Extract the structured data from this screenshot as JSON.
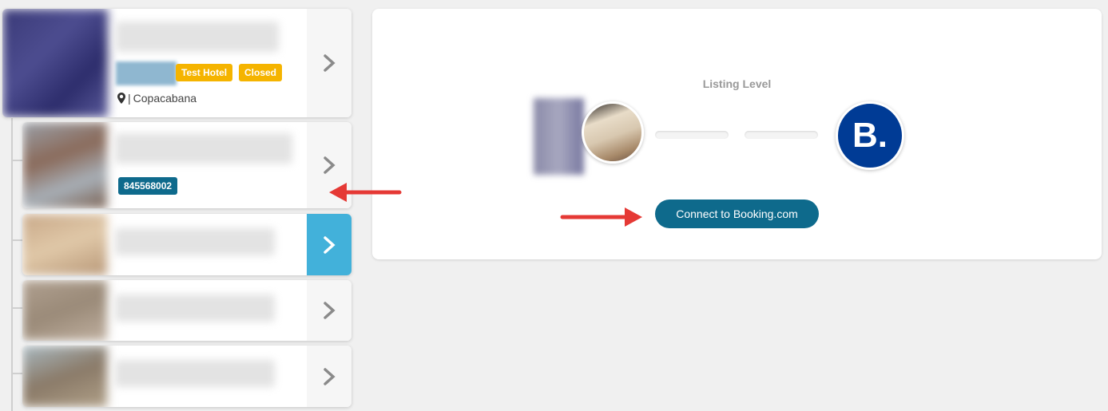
{
  "hotels": [
    {
      "tags": [
        "Test Hotel",
        "Closed"
      ],
      "location_separator": "|",
      "location": "Copacabana"
    },
    {
      "id_badge": "845568002"
    }
  ],
  "panel": {
    "listing_level_label": "Listing Level",
    "booking_logo_text": "B.",
    "connect_button_label": "Connect to Booking.com"
  },
  "icons": {
    "card_arrow": "chevron-right-icon",
    "location": "map-pin-icon"
  },
  "colors": {
    "accent_amber": "#f5b400",
    "accent_teal": "#0e6a8c",
    "active_arrow_bg": "#42b1da",
    "booking_blue": "#003b95",
    "annotation_red": "#e53935"
  }
}
